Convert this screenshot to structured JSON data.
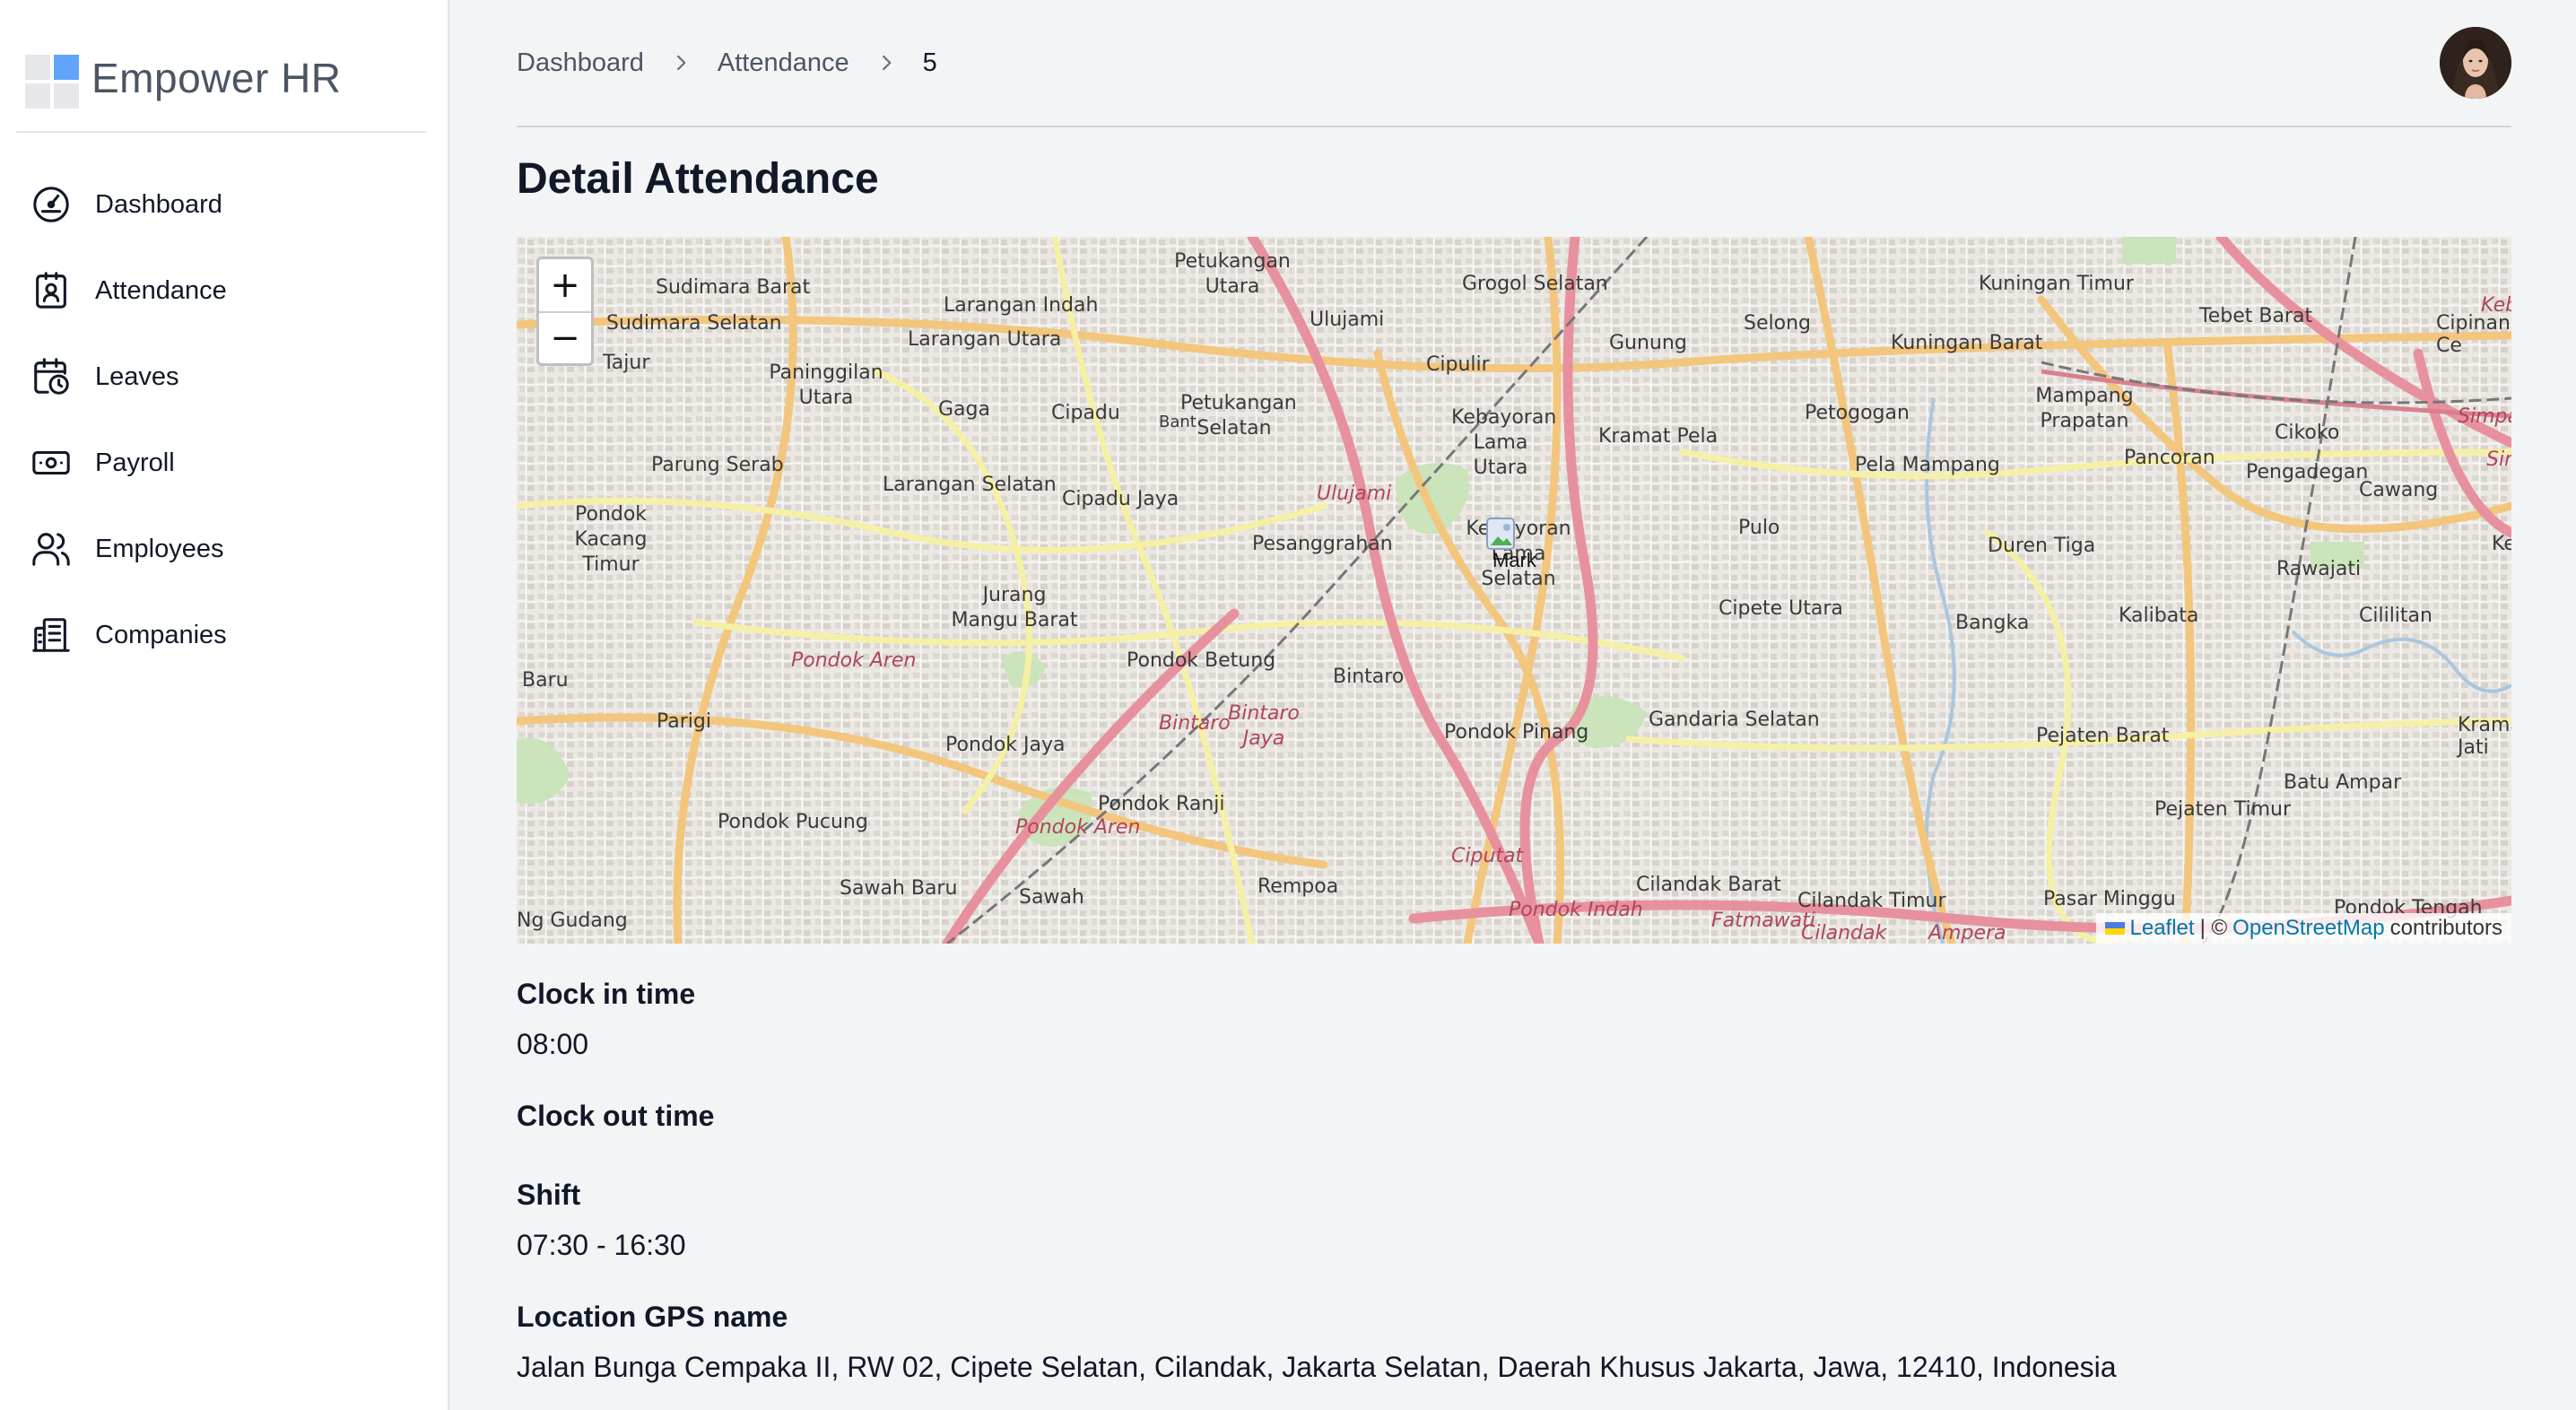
{
  "brand": {
    "name": "Empower HR"
  },
  "sidebar": {
    "items": [
      {
        "label": "Dashboard",
        "icon": "gauge-icon"
      },
      {
        "label": "Attendance",
        "icon": "badge-icon"
      },
      {
        "label": "Leaves",
        "icon": "calendar-clock-icon"
      },
      {
        "label": "Payroll",
        "icon": "banknote-icon"
      },
      {
        "label": "Employees",
        "icon": "users-icon"
      },
      {
        "label": "Companies",
        "icon": "building-icon"
      }
    ]
  },
  "breadcrumb": [
    "Dashboard",
    "Attendance",
    "5"
  ],
  "page": {
    "title": "Detail Attendance"
  },
  "map": {
    "zoom_in": "+",
    "zoom_out": "−",
    "marker_label": "Mark",
    "attribution": {
      "leaflet": "Leaflet",
      "separator": "| ©",
      "osm": "OpenStreetMap",
      "contributors": "contributors"
    },
    "places": [
      "Sudimara Barat",
      "Sudimara Selatan",
      "Tajur",
      "Petukangan Utara",
      "Larangan Indah",
      "Larangan Utara",
      "Paninggilan Utara",
      "Ulujami",
      "Grogol Selatan",
      "Gunung",
      "Selong",
      "Kuningan Barat",
      "Kuningan Timur",
      "Tebet Barat",
      "Cipulir",
      "Gaga",
      "Cipadu",
      "Petukangan Selatan",
      "Kebayoran Lama Utara",
      "Kramat Pela",
      "Petogogan",
      "Mampang Prapatan",
      "Parung Serab",
      "Larangan Selatan",
      "Cipadu Jaya",
      "Pela Mampang",
      "Pancoran",
      "Cikoko",
      "Pengadegan",
      "Cawang",
      "Pondok Kacang Timur",
      "Pesanggrahan",
      "Pulo",
      "Duren Tiga",
      "Rawajati",
      "Jurang Mangu Barat",
      "Cipete Utara",
      "Bangka",
      "Kalibata",
      "Cililitan",
      "Pondok Aren",
      "Pondok Betung",
      "Bintaro",
      "Parigi",
      "Pondok Jaya",
      "Pondok Pinang",
      "Gandaria Selatan",
      "Pejaten Barat",
      "Kramat Jati",
      "Batu Ampar",
      "Pondok Pucung",
      "Pondok Ranji",
      "Pejaten Timur",
      "Sawah Baru",
      "Sawah",
      "Rempoa",
      "Cilandak Barat",
      "Cilandak Timur",
      "Pasar Minggu",
      "Pondok Indah",
      "Fatmawati",
      "Ampera",
      "Ciputat",
      "Cilandak",
      "Simpang",
      "Ulujami",
      "Bintaro",
      "Pondok Aren",
      "Sim",
      "Keb",
      "Ke",
      "Baru",
      "Ng Gudang",
      "Bintaro Jaya",
      "Cipinang Ce",
      "Pondok Tengah",
      "Kebayoran Lama Selatan",
      "Bant"
    ]
  },
  "details": {
    "clock_in_label": "Clock in time",
    "clock_in_value": "08:00",
    "clock_out_label": "Clock out time",
    "shift_label": "Shift",
    "shift_value": "07:30 - 16:30",
    "location_label": "Location GPS name",
    "location_value": "Jalan Bunga Cempaka II, RW 02, Cipete Selatan, Cilandak, Jakarta Selatan, Daerah Khusus Jakarta, Jawa, 12410, Indonesia"
  },
  "colors": {
    "accent": "#60a5fa",
    "logo_gray": "#e5e7eb",
    "text": "#111827",
    "muted": "#4b5563",
    "link": "#0078a8"
  }
}
